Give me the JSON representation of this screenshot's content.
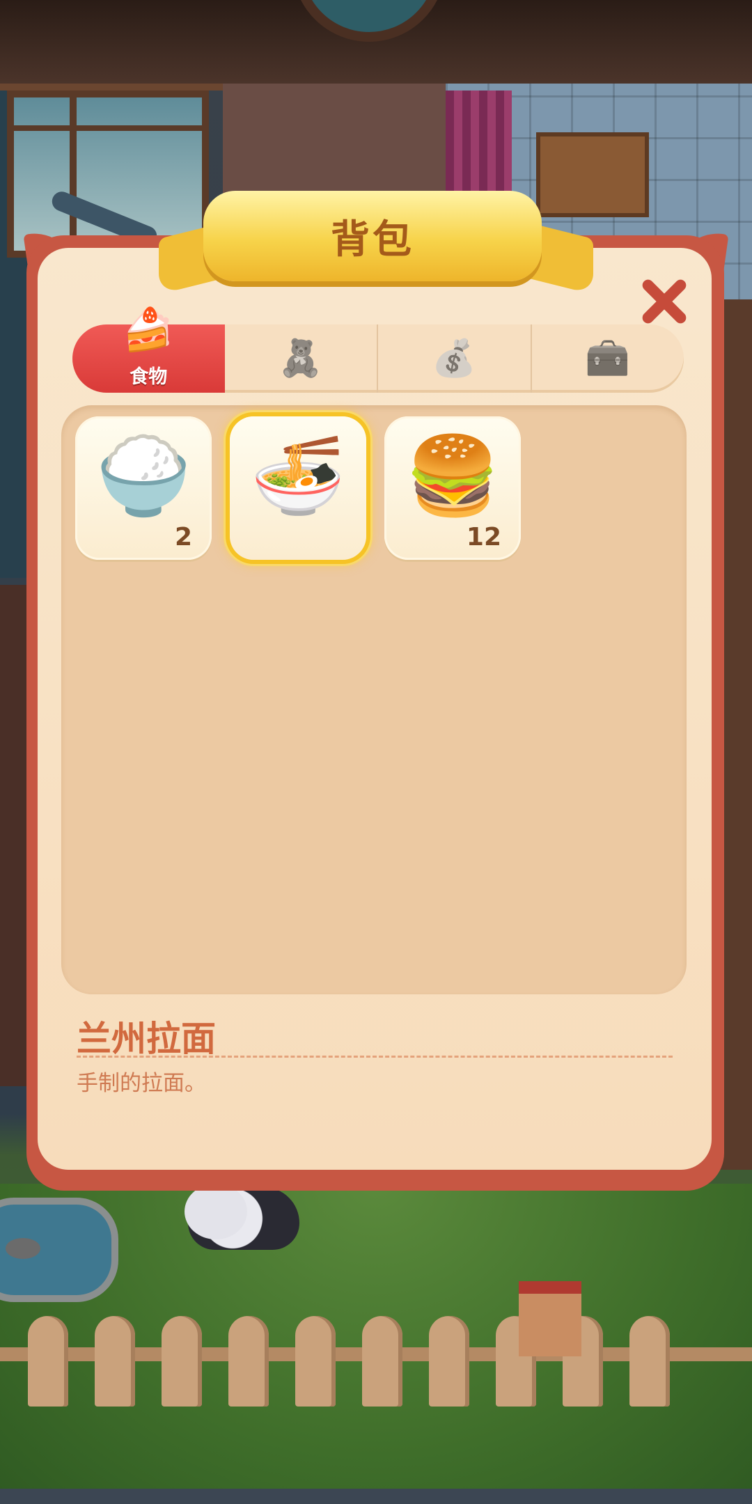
{
  "panel": {
    "title": "背包"
  },
  "tabs": [
    {
      "label": "食物",
      "icon": "cake-icon",
      "active": true
    },
    {
      "icon": "teddy-bear-icon",
      "active": false
    },
    {
      "icon": "money-bag-icon",
      "active": false
    },
    {
      "icon": "toolbox-icon",
      "active": false
    }
  ],
  "inventory": [
    {
      "icon": "fried-rice-dish-icon",
      "count": "2",
      "selected": false
    },
    {
      "icon": "ramen-bowl-icon",
      "count": "",
      "selected": true
    },
    {
      "icon": "hamburger-icon",
      "count": "12",
      "selected": false
    }
  ],
  "detail": {
    "name": "兰州拉面",
    "description": "手制的拉面。"
  },
  "colors": {
    "panel_border": "#c75743",
    "panel_fill": "#f9e7cd",
    "ribbon": "#f7d34a",
    "tab_active": "#e84a47",
    "name_text": "#d1693e",
    "selection_glow": "#f6c326"
  }
}
